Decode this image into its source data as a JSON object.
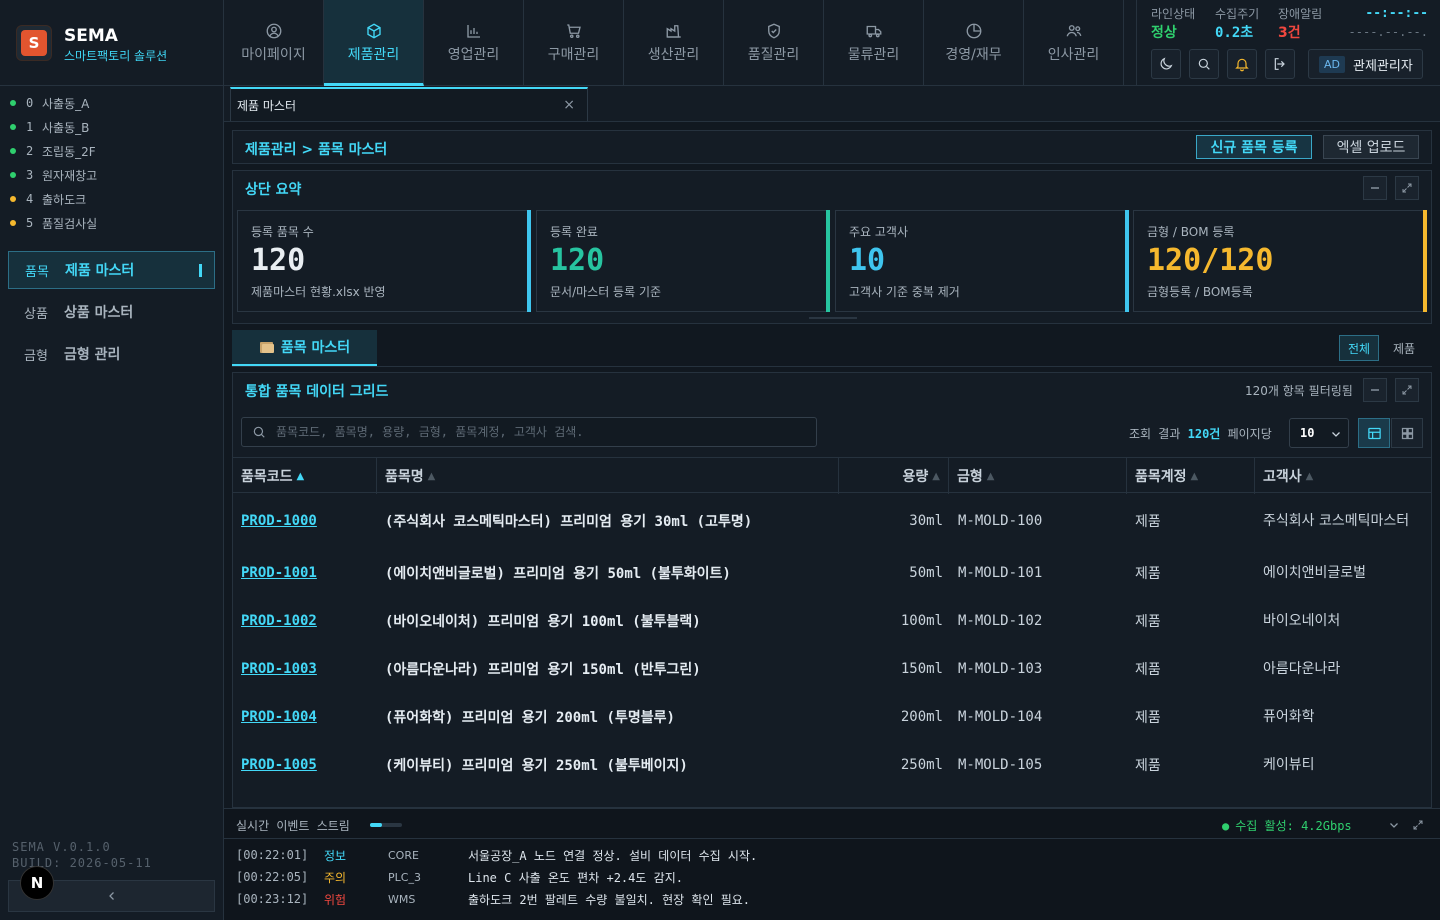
{
  "brand": {
    "logo_letter": "S",
    "name": "SEMA",
    "subtitle": "스마트팩토리 솔루션"
  },
  "nav": [
    {
      "label": "마이페이지",
      "icon": "user-circle-icon",
      "active": false
    },
    {
      "label": "제품관리",
      "icon": "box-icon",
      "active": true
    },
    {
      "label": "영업관리",
      "icon": "bar-chart-icon",
      "active": false
    },
    {
      "label": "구매관리",
      "icon": "cart-icon",
      "active": false
    },
    {
      "label": "생산관리",
      "icon": "factory-icon",
      "active": false
    },
    {
      "label": "품질관리",
      "icon": "shield-check-icon",
      "active": false
    },
    {
      "label": "물류관리",
      "icon": "truck-icon",
      "active": false
    },
    {
      "label": "경영/재무",
      "icon": "pie-chart-icon",
      "active": false
    },
    {
      "label": "인사관리",
      "icon": "users-icon",
      "active": false
    }
  ],
  "status": {
    "line_label": "라인상태",
    "line_value": "정상",
    "cycle_label": "수집주기",
    "cycle_value": "0.2초",
    "alarm_label": "장애알림",
    "alarm_value": "3건",
    "clock_time": "--:--:--",
    "clock_date": "----.--.--.",
    "admin_badge": "AD",
    "admin_name": "관제관리자"
  },
  "colors": {
    "accent": "#43d8f7",
    "ok": "#2fcf6e",
    "warn": "#f5b82e",
    "danger": "#f0473f",
    "brand": "#e2552f"
  },
  "zones": [
    {
      "idx": "0",
      "name": "사출동_A",
      "status": "ok"
    },
    {
      "idx": "1",
      "name": "사출동_B",
      "status": "ok"
    },
    {
      "idx": "2",
      "name": "조립동_2F",
      "status": "ok"
    },
    {
      "idx": "3",
      "name": "원자재창고",
      "status": "ok"
    },
    {
      "idx": "4",
      "name": "출하도크",
      "status": "warn"
    },
    {
      "idx": "5",
      "name": "품질검사실",
      "status": "warn"
    }
  ],
  "sidebar_menu": [
    {
      "prefix": "품목",
      "label": "제품 마스터",
      "active": true
    },
    {
      "prefix": "상품",
      "label": "상품 마스터",
      "active": false
    },
    {
      "prefix": "금형",
      "label": "금형 관리",
      "active": false
    }
  ],
  "version": {
    "line1": "SEMA V.0.1.0",
    "line2": "BUILD: 2026-05-11"
  },
  "n_badge": "N",
  "collapse_icon": "chevron-left-icon",
  "tab": {
    "label": "제품 마스터",
    "close": "×"
  },
  "breadcrumb": {
    "text": "제품관리 > 품목 마스터",
    "btn_new": "신규 품목 등록",
    "btn_excel": "엑셀 업로드"
  },
  "summary": {
    "title": "상단 요약",
    "cards": [
      {
        "label": "등록 품목 수",
        "value": "120",
        "sub": "제품마스터 현황.xlsx 반영",
        "color": "#3fc5ee"
      },
      {
        "label": "등록 완료",
        "value": "120",
        "sub": "문서/마스터 등록 기준",
        "color": "#27c4a0"
      },
      {
        "label": "주요 고객사",
        "value": "10",
        "sub": "고객사 기준 중복 제거",
        "color": "#3fc5ee"
      },
      {
        "label": "금형 / BOM 등록",
        "value": "120/120",
        "sub": "금형등록 / BOM등록",
        "color": "#f5b82e"
      }
    ]
  },
  "master_tab": {
    "label": "품목 마스터",
    "icon": "folder-icon"
  },
  "filters": {
    "all": "전체",
    "product": "제품"
  },
  "grid": {
    "title": "통합 품목 데이터 그리드",
    "filtered": "120개 항목 필터링됨",
    "search_placeholder": "품목코드, 품목명, 용량, 금형, 품목계정, 고객사 검색.",
    "result_prefix": "조회 결과 ",
    "result_count": "120건",
    "result_suffix": " 페이지당",
    "per_page": "10",
    "columns": [
      "품목코드",
      "품목명",
      "용량",
      "금형",
      "품목계정",
      "고객사"
    ],
    "rows": [
      {
        "code": "PROD-1000",
        "name": "(주식회사 코스메틱마스터) 프리미엄 용기 30ml (고투명)",
        "cap": "30ml",
        "mold": "M-MOLD-100",
        "type": "제품",
        "cust": "주식회사 코스메틱마스터"
      },
      {
        "code": "PROD-1001",
        "name": "(에이치앤비글로벌) 프리미엄 용기 50ml (불투화이트)",
        "cap": "50ml",
        "mold": "M-MOLD-101",
        "type": "제품",
        "cust": "에이치앤비글로벌"
      },
      {
        "code": "PROD-1002",
        "name": "(바이오네이처) 프리미엄 용기 100ml (불투블랙)",
        "cap": "100ml",
        "mold": "M-MOLD-102",
        "type": "제품",
        "cust": "바이오네이처"
      },
      {
        "code": "PROD-1003",
        "name": "(아름다운나라) 프리미엄 용기 150ml (반투그린)",
        "cap": "150ml",
        "mold": "M-MOLD-103",
        "type": "제품",
        "cust": "아름다운나라"
      },
      {
        "code": "PROD-1004",
        "name": "(퓨어화학) 프리미엄 용기 200ml (투명블루)",
        "cap": "200ml",
        "mold": "M-MOLD-104",
        "type": "제품",
        "cust": "퓨어화학"
      },
      {
        "code": "PROD-1005",
        "name": "(케이뷰티) 프리미엄 용기 250ml (불투베이지)",
        "cap": "250ml",
        "mold": "M-MOLD-105",
        "type": "제품",
        "cust": "케이뷰티"
      }
    ]
  },
  "stream": {
    "title": "실시간 이벤트 스트림",
    "status": "수집 활성: 4.2Gbps",
    "logs": [
      {
        "time": "[00:22:01]",
        "level": "정보",
        "level_color": "#43d8f7",
        "source": "CORE",
        "msg": "서울공장_A 노드 연결 정상. 설비 데이터 수집 시작."
      },
      {
        "time": "[00:22:05]",
        "level": "주의",
        "level_color": "#f5b82e",
        "source": "PLC_3",
        "msg": "Line C 사출 온도 편차 +2.4도 감지."
      },
      {
        "time": "[00:23:12]",
        "level": "위험",
        "level_color": "#f0473f",
        "source": "WMS",
        "msg": "출하도크 2번 팔레트 수량 불일치. 현장 확인 필요."
      }
    ]
  }
}
